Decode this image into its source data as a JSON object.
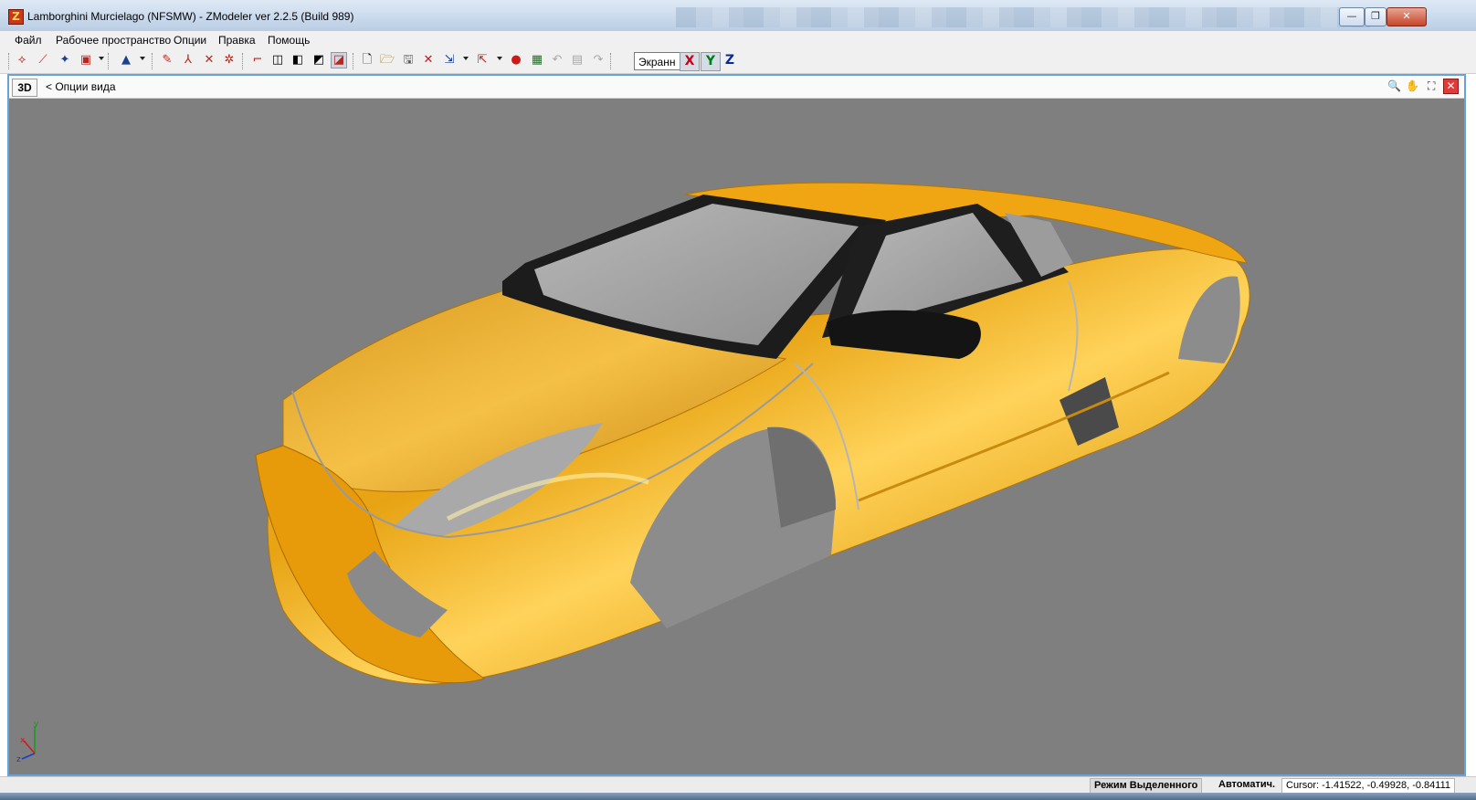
{
  "window": {
    "title": "Lamborghini Murcielago  (NFSMW) - ZModeler ver 2.2.5 (Build 989)",
    "app_icon_letter": "Z",
    "minimize_glyph": "—",
    "maximize_glyph": "❐",
    "close_glyph": "✕"
  },
  "menu": {
    "items": [
      {
        "label": "Файл"
      },
      {
        "label": "Рабочее пространство"
      },
      {
        "label": "Опции"
      },
      {
        "label": "Правка"
      },
      {
        "label": "Помощь"
      }
    ]
  },
  "toolbar": {
    "view_mode_value": "Экранн",
    "axis_x": "X",
    "axis_y": "Y",
    "axis_z": "Z",
    "axis_colors": {
      "x": "#c8001c",
      "y": "#007a1e",
      "z": "#0a2a9c"
    }
  },
  "viewport": {
    "mode_label": "3D",
    "options_label": "<  Опции вида",
    "background_color": "#7f7f7f",
    "body_color": "#f0a010",
    "gizmo": {
      "x": "x",
      "y": "y",
      "z": "z"
    }
  },
  "status": {
    "mode": "Режим Выделенного",
    "auto": "Автоматич.",
    "cursor": "Cursor: -1.41522, -0.49928, -0.84111"
  }
}
